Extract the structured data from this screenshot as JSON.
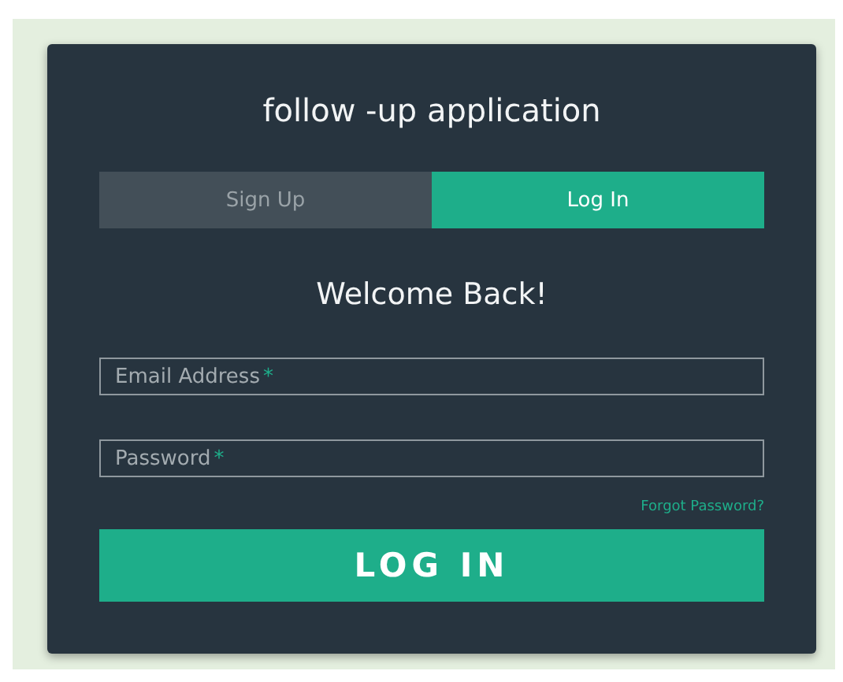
{
  "title": "follow -up application",
  "tabs": [
    {
      "label": "Sign Up",
      "selected": false
    },
    {
      "label": "Log In",
      "selected": true
    }
  ],
  "heading": "Welcome Back!",
  "fields": [
    {
      "placeholder": "Email Address",
      "required_mark": "*"
    },
    {
      "placeholder": "Password",
      "required_mark": "*"
    }
  ],
  "forgot_link": "Forgot Password?",
  "submit_button": "LOG IN"
}
